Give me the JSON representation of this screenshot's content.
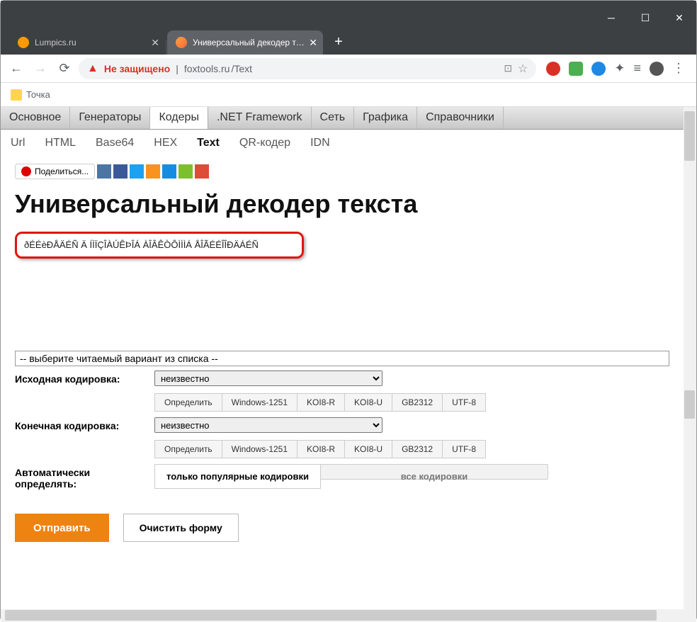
{
  "window": {
    "tabs": [
      {
        "title": "Lumpics.ru"
      },
      {
        "title": "Универсальный декодер текста"
      }
    ]
  },
  "address": {
    "not_secure": "Не защищено",
    "host": "foxtools.ru",
    "path": "/Text"
  },
  "bookmarks": {
    "item1": "Точка"
  },
  "main_nav": {
    "items": [
      "Основное",
      "Генераторы",
      "Кодеры",
      ".NET Framework",
      "Сеть",
      "Графика",
      "Справочники"
    ]
  },
  "sub_nav": {
    "items": [
      "Url",
      "HTML",
      "Base64",
      "HEX",
      "Text",
      "QR-кодер",
      "IDN"
    ]
  },
  "share": {
    "label": "Поделиться..."
  },
  "page": {
    "title": "Универсальный декодер текста",
    "garbled_text": "ðÉÉèÐÅÄÉÑ Ä ÍÌÏÇÎÀÚÊÞÎÁ ÀÎÂÊÒÔÌÌÌÁ ÅÎÃÉÉÎÎÐÄÁÉÑ",
    "variant_placeholder": "-- выберите читаемый вариант из списка --",
    "label_source": "Исходная кодировка:",
    "label_target": "Конечная кодировка:",
    "label_auto": "Автоматически определять:",
    "select_value": "неизвестно",
    "enc_buttons": [
      "Определить",
      "Windows-1251",
      "KOI8-R",
      "KOI8-U",
      "GB2312",
      "UTF-8"
    ],
    "auto_popular": "только популярные кодировки",
    "auto_all": "все кодировки",
    "submit": "Отправить",
    "clear": "Очистить форму"
  }
}
